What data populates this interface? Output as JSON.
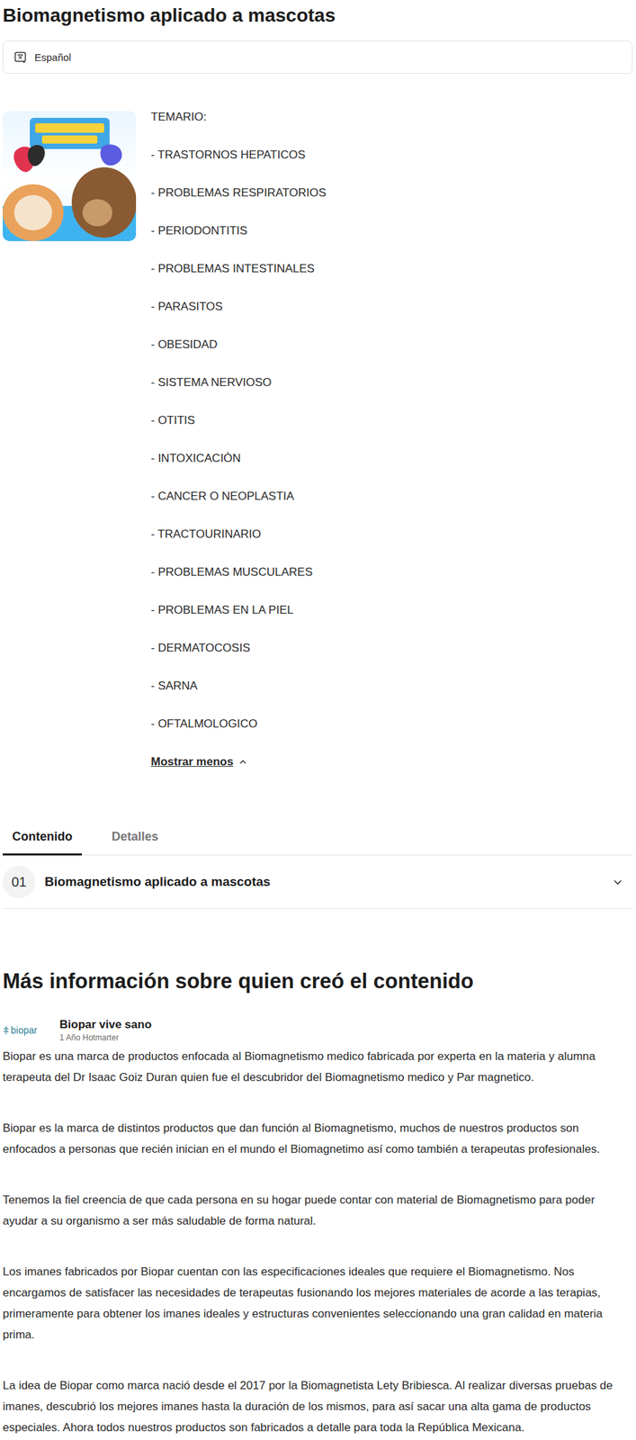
{
  "title": "Biomagnetismo aplicado a mascotas",
  "language": {
    "label": "Español"
  },
  "description": {
    "heading": "TEMARIO:",
    "items": [
      "- TRASTORNOS HEPATICOS",
      "- PROBLEMAS RESPIRATORIOS",
      "- PERIODONTITIS",
      "- PROBLEMAS INTESTINALES",
      "- PARASITOS",
      "- OBESIDAD",
      "- SISTEMA NERVIOSO",
      "- OTITIS",
      "- INTOXICACIÒN",
      "- CANCER O NEOPLASTIA",
      "- TRACTOURINARIO",
      "- PROBLEMAS MUSCULARES",
      "- PROBLEMAS EN LA PIEL",
      "- DERMATOCOSIS",
      "- SARNA",
      "- OFTALMOLOGICO"
    ],
    "toggle": {
      "label": "Mostrar menos",
      "expanded": true
    }
  },
  "tabs": [
    {
      "label": "Contenido",
      "selected": true
    },
    {
      "label": "Detalles",
      "selected": false
    }
  ],
  "modules": [
    {
      "number": "01",
      "title": "Biomagnetismo aplicado a mascotas",
      "expanded": false
    }
  ],
  "creator": {
    "heading": "Más información sobre quien creó el contenido",
    "logo_text": "biopar",
    "name": "Biopar vive sano",
    "tenure": "1 Año Hotmarter",
    "paragraphs": [
      "Biopar es una marca de productos enfocada al Biomagnetismo medico fabricada por experta en la materia y alumna terapeuta del Dr Isaac Goiz Duran quien fue el descubridor del Biomagnetismo medico y Par magnetico.",
      "Biopar es la marca de distintos productos que dan función al Biomagnetismo, muchos de nuestros productos son enfocados a personas que recién inician en el mundo el Biomagnetimo así como también a terapeutas profesionales.",
      "Tenemos la fiel creencia de que cada persona en su hogar puede contar con material de Biomagnetismo para poder ayudar a su organismo a ser más saludable de forma natural.",
      "Los imanes fabricados por Biopar cuentan con las especificaciones ideales que requiere el Biomagnetismo. Nos encargamos de satisfacer las necesidades de terapeutas fusionando los mejores materiales de acorde a las terapias, primeramente para obtener los imanes ideales y estructuras convenientes seleccionando una gran calidad en materia prima.",
      "La idea de Biopar como marca nació desde el 2017 por la Biomagnetista Lety Bribiesca. Al realizar diversas pruebas de imanes, descubrió los mejores imanes hasta la duración de los mismos, para así sacar una alta gama de productos especiales. Ahora todos nuestros productos son fabricados a detalle para toda la República Mexicana."
    ]
  }
}
